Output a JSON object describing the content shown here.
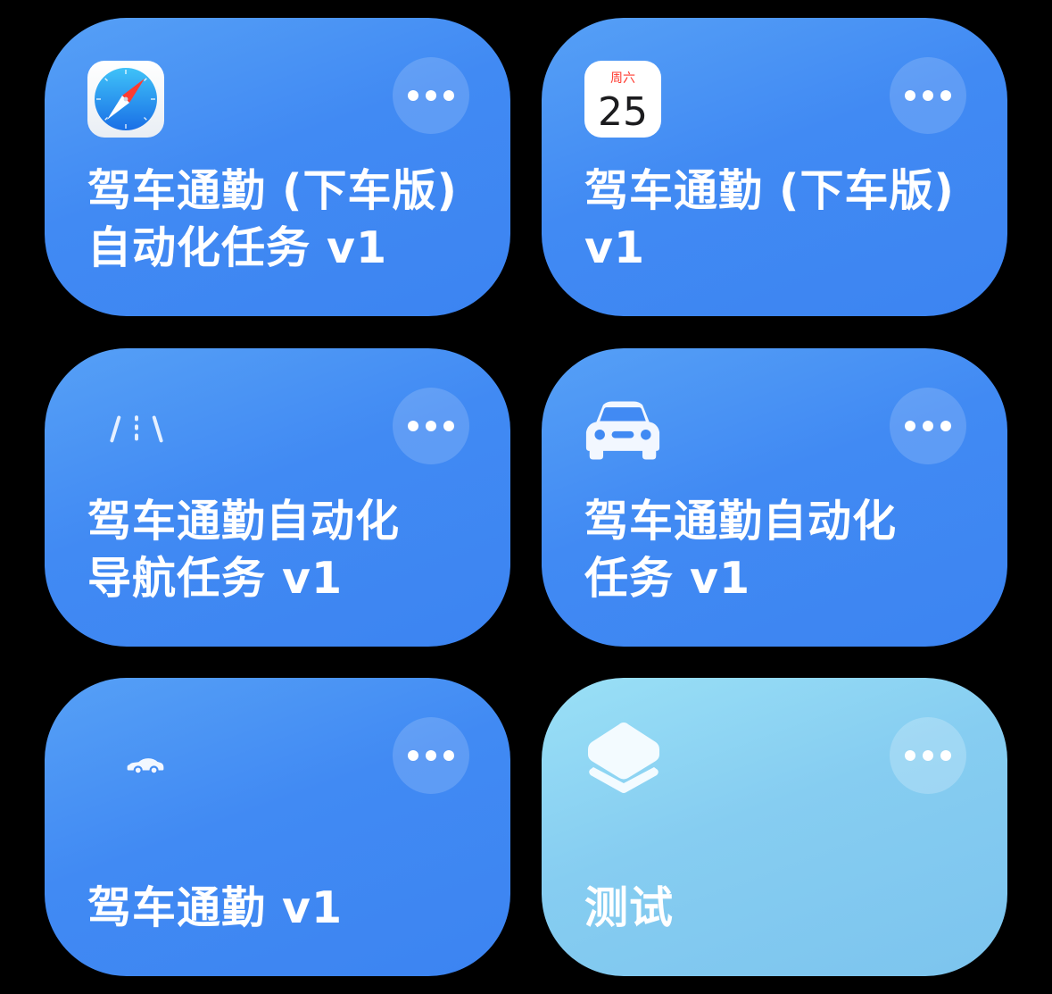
{
  "tiles": [
    {
      "icon": "safari-compass-icon",
      "title_lines": [
        "驾车通勤 (下车版)",
        "自动化任务 v1"
      ],
      "accent": "#418af3"
    },
    {
      "icon": "calendar-icon",
      "calendar": {
        "weekday": "周六",
        "day": "25"
      },
      "title_lines": [
        "驾车通勤 (下车版)",
        "v1"
      ],
      "accent": "#418af3"
    },
    {
      "icon": "road-lanes-icon",
      "title_lines": [
        "驾车通勤自动化",
        "导航任务 v1"
      ],
      "accent": "#418af3"
    },
    {
      "icon": "car-front-icon",
      "title_lines": [
        "驾车通勤自动化",
        "任务 v1"
      ],
      "accent": "#418af3"
    },
    {
      "icon": "car-side-icon",
      "title_lines": [
        "驾车通勤 v1"
      ],
      "accent": "#418af3"
    },
    {
      "icon": "layers-stack-icon",
      "title_lines": [
        "测试"
      ],
      "accent": "#86cdf1"
    }
  ]
}
